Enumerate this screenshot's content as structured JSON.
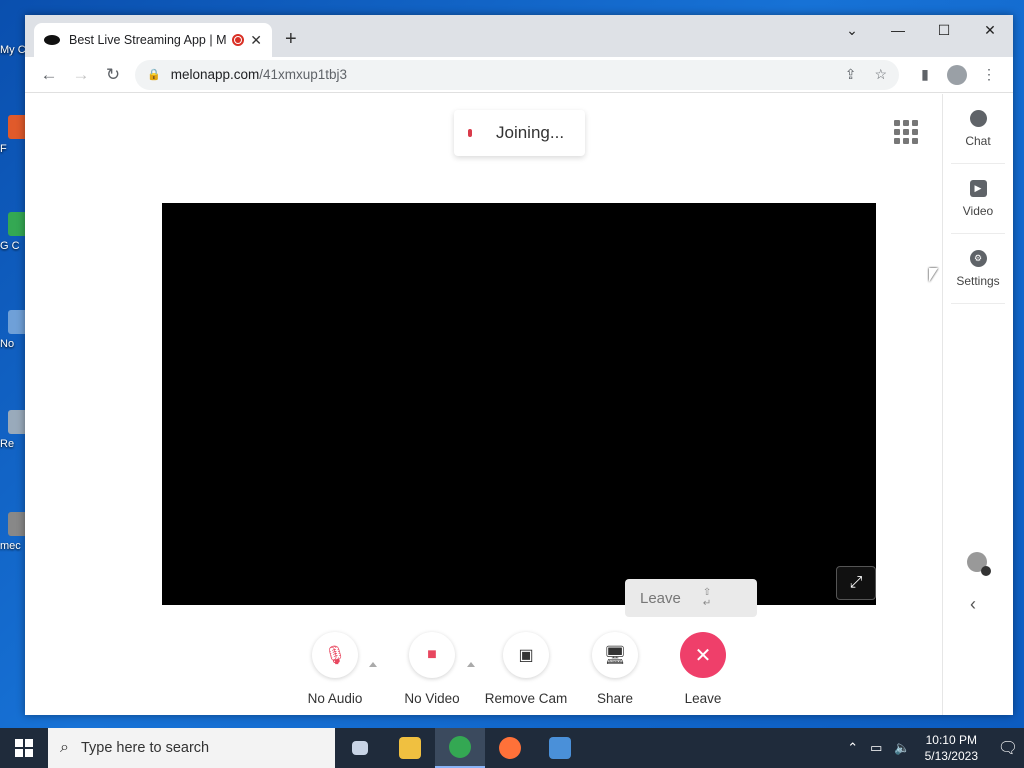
{
  "desktop": {
    "icons": [
      {
        "label": "My C",
        "color": "#2a6fd8"
      },
      {
        "label": "F",
        "color": "#e05a2b"
      },
      {
        "label": "G C",
        "color": "#34a853"
      },
      {
        "label": "No",
        "color": "#6fa0d8"
      },
      {
        "label": "Re",
        "color": "#9ab"
      },
      {
        "label": "mec",
        "color": "#888"
      }
    ]
  },
  "browser": {
    "tab_title": "Best Live Streaming App | Me",
    "url_host": "melonapp.com",
    "url_path": "/41xmxup1tbj3",
    "window_controls": [
      "⌄",
      "—",
      "☐",
      "✕"
    ]
  },
  "app": {
    "status_text": "Joining...",
    "tooltip": {
      "label": "Leave",
      "shortcut": "⇧ ↵"
    },
    "controls": [
      {
        "id": "audio",
        "label": "No Audio",
        "icon": "mic-off-icon",
        "glyph": "🎙",
        "color": "#e8475f",
        "has_caret": true
      },
      {
        "id": "video",
        "label": "No Video",
        "icon": "camera-icon",
        "glyph": "▰",
        "color": "#e8475f",
        "has_caret": true
      },
      {
        "id": "remove_cam",
        "label": "Remove Cam",
        "icon": "remove-camera-icon",
        "glyph": "▣",
        "color": "#333",
        "has_caret": false
      },
      {
        "id": "share",
        "label": "Share",
        "icon": "monitor-icon",
        "glyph": "▭",
        "color": "#333",
        "has_caret": false
      },
      {
        "id": "leave",
        "label": "Leave",
        "icon": "close-icon",
        "glyph": "✕",
        "color": "#ffffff",
        "has_caret": false
      }
    ],
    "rail": [
      {
        "label": "Chat",
        "icon": "chat-icon"
      },
      {
        "label": "Video",
        "icon": "play-icon"
      },
      {
        "label": "Settings",
        "icon": "gear-icon"
      }
    ]
  },
  "taskbar": {
    "search_placeholder": "Type here to search",
    "time": "10:10 PM",
    "date": "5/13/2023",
    "apps": [
      {
        "name": "task-view-icon",
        "color": "#c8d4e6"
      },
      {
        "name": "file-explorer-icon",
        "color": "#f0c040"
      },
      {
        "name": "chrome-icon",
        "color": "#34a853"
      },
      {
        "name": "firefox-icon",
        "color": "#ff7139"
      },
      {
        "name": "remote-desktop-icon",
        "color": "#4a90d9"
      }
    ]
  }
}
